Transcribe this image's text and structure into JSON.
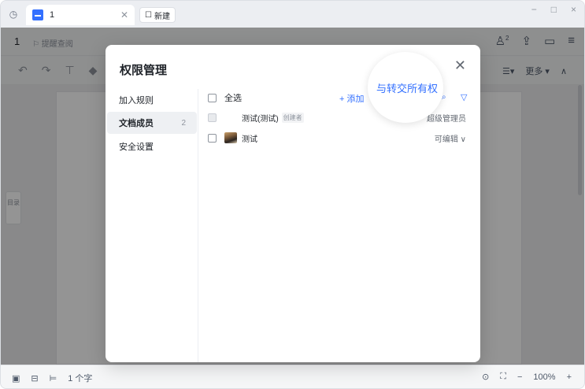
{
  "titlebar": {
    "tab_label": "1",
    "new_button_label": "新建",
    "controls": [
      "−",
      "□",
      "×"
    ]
  },
  "docheader": {
    "title": "1",
    "remind_label": "提醒查阅",
    "collab_count": "2"
  },
  "toolbar": {
    "more_label": "更多"
  },
  "sidebar_toc": {
    "label": "目录"
  },
  "statusbar": {
    "word_count": "1 个字",
    "zoom": "100%"
  },
  "dialog": {
    "title": "权限管理",
    "menu": [
      {
        "label": "加入规则"
      },
      {
        "label": "文档成员",
        "count": "2",
        "active": true
      },
      {
        "label": "安全设置"
      }
    ],
    "select_all_label": "全选",
    "add_label": "+ 添加",
    "transfer_label": "与转交所有权",
    "members": [
      {
        "name": "测试(测试)",
        "tag": "创建者",
        "role": "超级管理员",
        "checkbox_disabled": true
      },
      {
        "name": "测试",
        "tag": "",
        "role": "可编辑 ∨",
        "checkbox_disabled": false
      }
    ]
  },
  "colors": {
    "accent": "#3370ff",
    "overlay": "rgba(0,0,0,0.42)"
  }
}
